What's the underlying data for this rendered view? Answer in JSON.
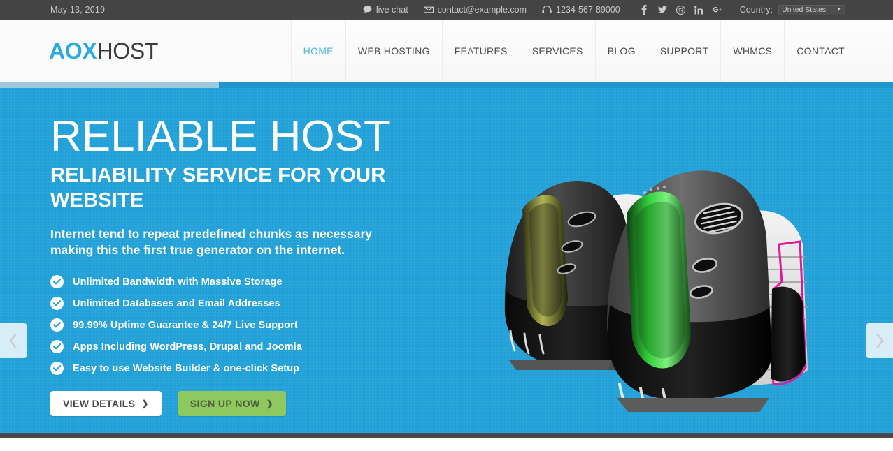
{
  "topbar": {
    "date": "May 13, 2019",
    "live_chat": "live chat",
    "email": "contact@example.com",
    "phone": "1234-567-89000",
    "socials": [
      {
        "name": "facebook-icon",
        "glyph": "f"
      },
      {
        "name": "twitter-icon",
        "glyph": "t"
      },
      {
        "name": "github-icon",
        "glyph": "g"
      },
      {
        "name": "linkedin-icon",
        "glyph": "in"
      },
      {
        "name": "google-plus-icon",
        "glyph": "g+"
      }
    ],
    "country_label": "Country:",
    "country_value": "United States",
    "country_caret": "▼"
  },
  "header": {
    "logo_primary": "AOX",
    "logo_secondary": "HOST",
    "nav": [
      {
        "label": "HOME",
        "active": true
      },
      {
        "label": "WEB HOSTING",
        "active": false
      },
      {
        "label": "FEATURES",
        "active": false
      },
      {
        "label": "SERVICES",
        "active": false
      },
      {
        "label": "BLOG",
        "active": false
      },
      {
        "label": "SUPPORT",
        "active": false
      },
      {
        "label": "WHMCS",
        "active": false
      },
      {
        "label": "CONTACT",
        "active": false
      }
    ]
  },
  "hero": {
    "title": "RELIABLE HOST",
    "subtitle": "RELIABILITY SERVICE FOR YOUR WEBSITE",
    "lead": "Internet tend to repeat predefined chunks as necessary making this the first true generator on the internet.",
    "features": [
      "Unlimited Bandwidth with Massive Storage",
      "Unlimited Databases and Email Addresses",
      "99.99% Uptime Guarantee & 24/7 Live Support",
      "Apps Including WordPress, Drupal and Joomla",
      "Easy to use Website Builder & one-click Setup"
    ],
    "buttons": {
      "view_details": "VIEW DETAILS",
      "sign_up": "SIGN UP NOW",
      "chevron": "❯"
    },
    "prev_arrow": "‹",
    "next_arrow": "›"
  },
  "colors": {
    "accent_blue": "#22a1d8",
    "logo_blue": "#29abe2",
    "nav_active": "#4db8e8",
    "green_button": "#8dc95f",
    "topbar_dark": "#444444",
    "progress_fill": "#9cc9dd"
  }
}
